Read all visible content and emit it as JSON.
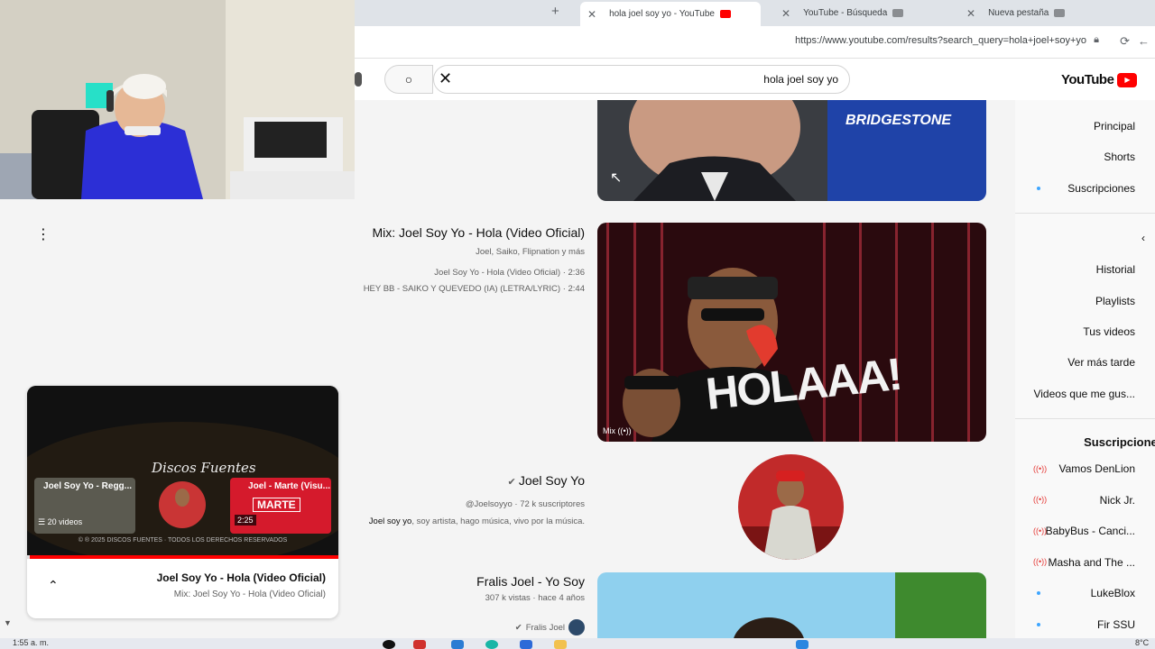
{
  "browser": {
    "tabs": [
      {
        "label": "hola joel soy yo - YouTube",
        "active": true,
        "favicon_color": "#ff0000"
      },
      {
        "label": "YouTube - Búsqueda",
        "active": false,
        "favicon_color": "#5f6368"
      },
      {
        "label": "Nueva pestaña",
        "active": false,
        "favicon_color": "#5f6368"
      }
    ],
    "url": "https://www.youtube.com/results?search_query=hola+joel+soy+yo"
  },
  "youtube": {
    "logo_text": "YouTube",
    "search": {
      "value": "hola joel soy yo"
    },
    "sidebar": {
      "items": [
        "Principal",
        "Shorts",
        "Suscripciones"
      ],
      "you_items": [
        "Historial",
        "Playlists",
        "Tus videos",
        "Ver más tarde",
        "Videos que me gus..."
      ],
      "subs_header": "Suscripciones",
      "subscriptions": [
        {
          "name": "Vamos DenLion",
          "live": true
        },
        {
          "name": "Nick Jr.",
          "live": true
        },
        {
          "name": "BabyBus - Canci...",
          "live": true
        },
        {
          "name": "Masha and The ...",
          "live": true
        },
        {
          "name": "LukeBlox",
          "live": false
        },
        {
          "name": "Fir SSU",
          "live": false
        }
      ]
    },
    "results": [
      {
        "type": "ad",
        "brand_text": "BRIDGESTONE"
      },
      {
        "type": "mix",
        "title": "Mix: Joel Soy Yo - Hola (Video Oficial)",
        "channels": "Joel, Saiko, Flipnation y más",
        "lines": [
          "Joel Soy Yo - Hola (Video Oficial) · 2:36",
          "HEY BB - SAIKO Y QUEVEDO (IA) (LETRA/LYRIC) · 2:44"
        ],
        "badge": "Mix",
        "thumb_text": "HOLAAA!"
      },
      {
        "type": "channel",
        "title": "Joel Soy Yo",
        "handle": "@Joelsoyyo · 72 k suscriptores",
        "desc_bold": "Joel soy yo",
        "desc": ", soy artista, hago música, vivo por la música."
      },
      {
        "type": "video",
        "title": "Fralis Joel - Yo Soy",
        "meta": "307 k vistas · hace 4 años",
        "channel": "Fralis Joel"
      }
    ],
    "miniplayer": {
      "title": "Joel Soy Yo - Hola (Video Oficial)",
      "subtitle": "Mix: Joel Soy Yo - Hola (Video Oficial)",
      "progress": 0.99,
      "end_screen": {
        "brand": "Discos Fuentes",
        "card1": "Joel - Marte (Visu...",
        "card1_time": "2:25",
        "card1_text": "MARTE",
        "card3": "Joel Soy Yo - Regg...",
        "card3_count": "20 videos",
        "copyright": "© ® 2025 DISCOS FUENTES · TODOS LOS DERECHOS RESERVADOS"
      }
    }
  },
  "taskbar": {
    "time": "1:55 a. m.",
    "temp": "8°C"
  }
}
